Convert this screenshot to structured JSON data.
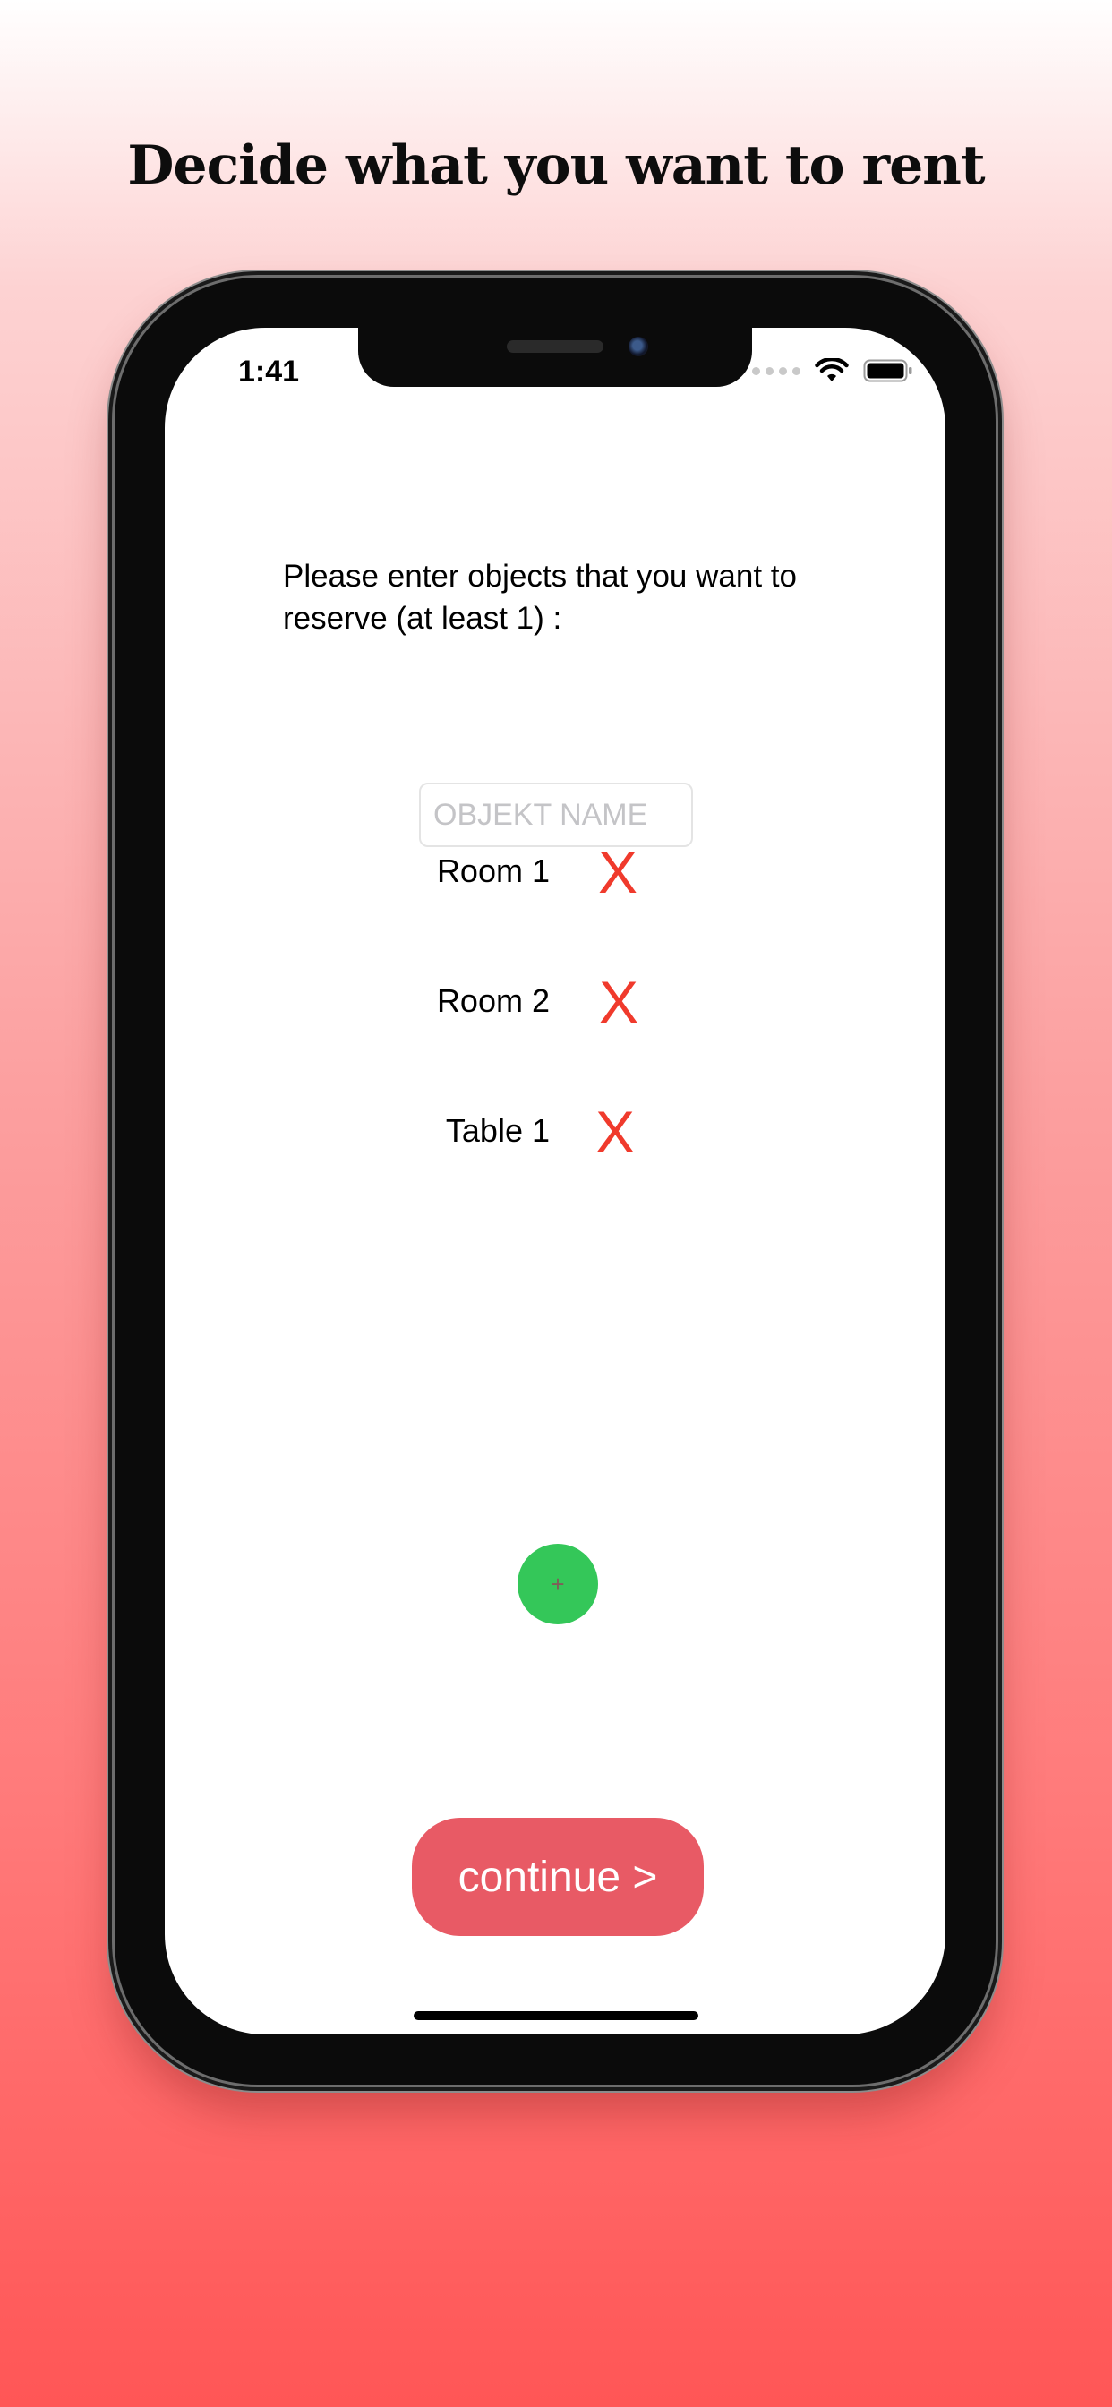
{
  "headline": "Decide what you want to rent",
  "status_bar": {
    "time": "1:41",
    "icons": [
      "signal-dots-icon",
      "wifi-icon",
      "battery-icon"
    ]
  },
  "instruction_text": "Please enter objects that you want to reserve (at least 1) :",
  "object_input": {
    "value": "",
    "placeholder": "OBJEKT NAME"
  },
  "objects": [
    {
      "label": "Room 1",
      "remove_label": "X"
    },
    {
      "label": "Room 2",
      "remove_label": "X"
    },
    {
      "label": "Table 1",
      "remove_label": "X"
    }
  ],
  "add_button": {
    "label": "+",
    "color": "#34c759"
  },
  "continue_button": {
    "label": "continue >",
    "color": "#e85a65"
  },
  "colors": {
    "remove_red": "#f03a2c",
    "background_top": "#ffffff",
    "background_bottom": "#ff5656"
  }
}
